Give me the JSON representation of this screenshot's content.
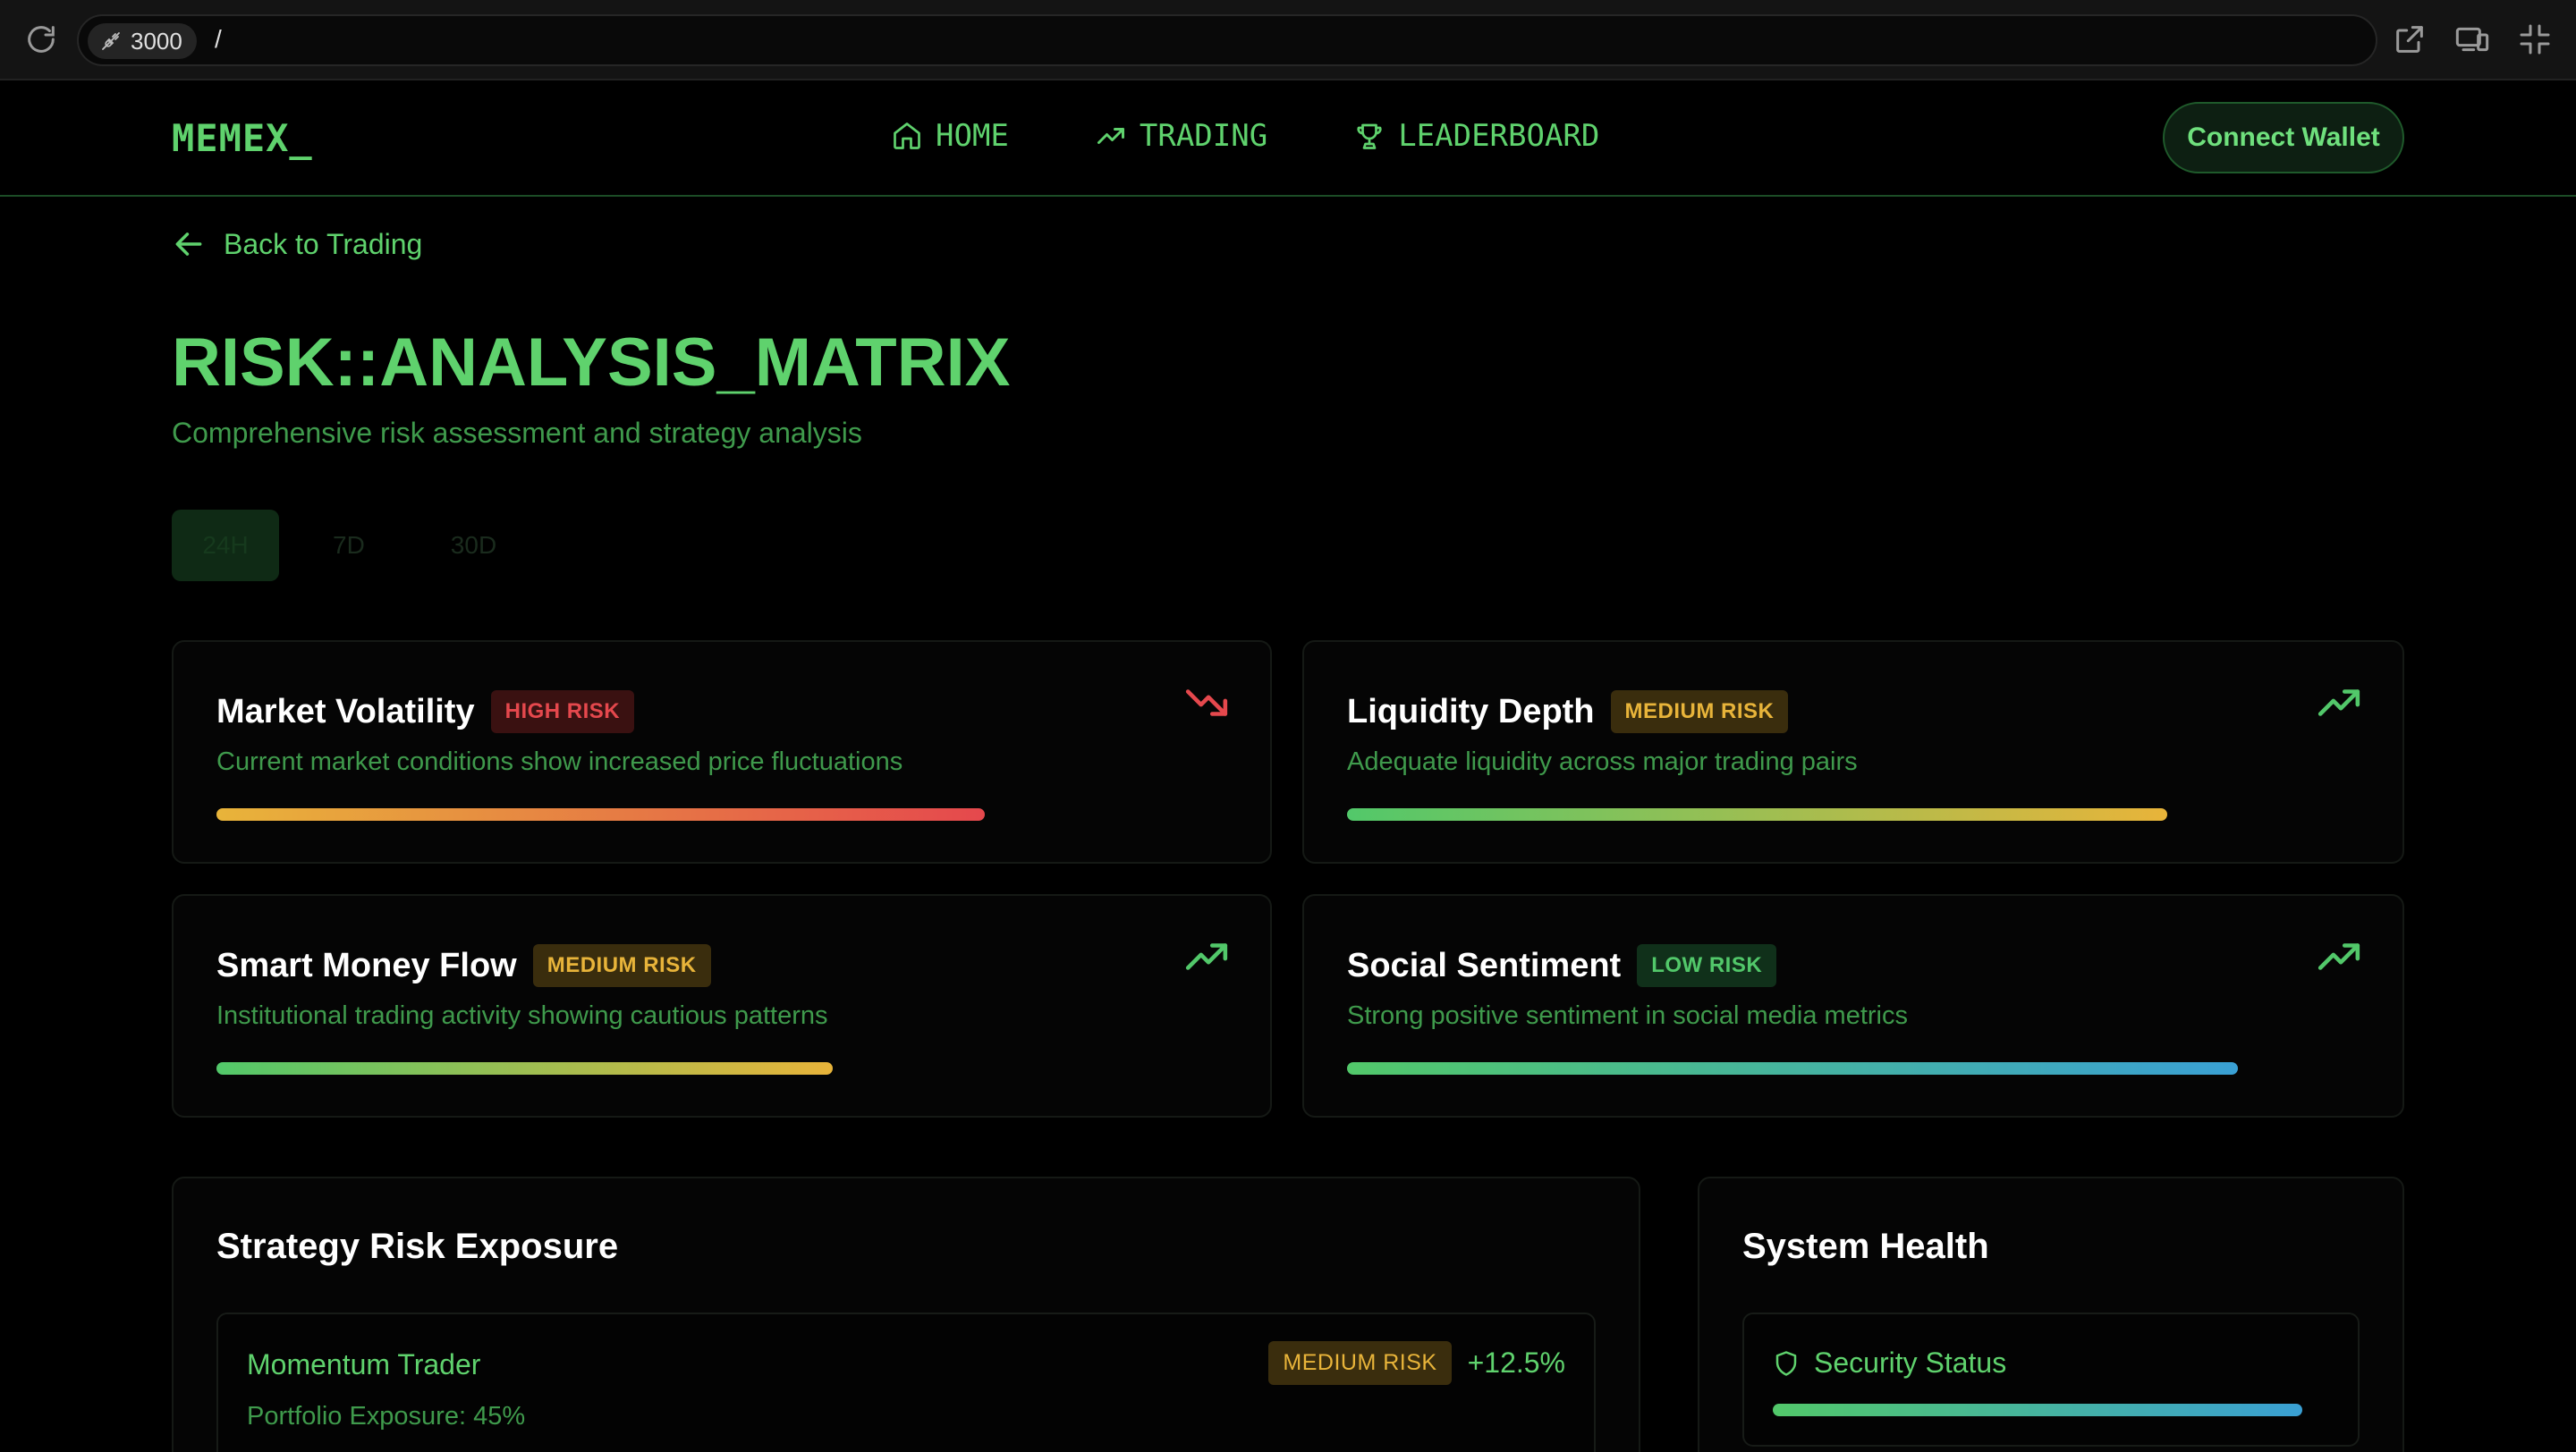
{
  "browser": {
    "port": "3000",
    "path": "/"
  },
  "nav": {
    "logo": "MEMEX_",
    "links": [
      {
        "label": "HOME",
        "icon": "home-icon"
      },
      {
        "label": "TRADING",
        "icon": "trending-up-icon"
      },
      {
        "label": "LEADERBOARD",
        "icon": "trophy-icon"
      }
    ],
    "connect_label": "Connect Wallet"
  },
  "back_label": "Back to Trading",
  "title": "RISK::ANALYSIS_MATRIX",
  "subtitle": "Comprehensive risk assessment and strategy analysis",
  "ranges": [
    {
      "label": "24H",
      "active": true
    },
    {
      "label": "7D",
      "active": false
    },
    {
      "label": "30D",
      "active": false
    }
  ],
  "metrics": [
    {
      "title": "Market Volatility",
      "badge": "HIGH RISK",
      "level": "high",
      "desc": "Current market conditions show increased price fluctuations",
      "trend": "down",
      "fill": 0.76,
      "gradient": [
        "#e8b43a",
        "#e5484d"
      ]
    },
    {
      "title": "Liquidity Depth",
      "badge": "MEDIUM RISK",
      "level": "medium",
      "desc": "Adequate liquidity across major trading pairs",
      "trend": "up",
      "fill": 0.81,
      "gradient": [
        "#52c86a",
        "#e8b43a"
      ]
    },
    {
      "title": "Smart Money Flow",
      "badge": "MEDIUM RISK",
      "level": "medium",
      "desc": "Institutional trading activity showing cautious patterns",
      "trend": "up",
      "fill": 0.61,
      "gradient": [
        "#52c86a",
        "#e8b43a"
      ]
    },
    {
      "title": "Social Sentiment",
      "badge": "LOW RISK",
      "level": "low",
      "desc": "Strong positive sentiment in social media metrics",
      "trend": "up",
      "fill": 0.88,
      "gradient": [
        "#52c86a",
        "#3aa0d4"
      ]
    }
  ],
  "strategy_panel": {
    "title": "Strategy Risk Exposure",
    "items": [
      {
        "name": "Momentum Trader",
        "badge": "MEDIUM RISK",
        "change": "+12.5%",
        "exposure": "Portfolio Exposure: 45%"
      }
    ]
  },
  "health_panel": {
    "title": "System Health",
    "items": [
      {
        "name": "Security Status",
        "icon": "shield-icon"
      }
    ]
  },
  "colors": {
    "accent": "#5fd26d",
    "high": "#e5484d",
    "medium": "#e8b43a",
    "low": "#52c86a"
  }
}
